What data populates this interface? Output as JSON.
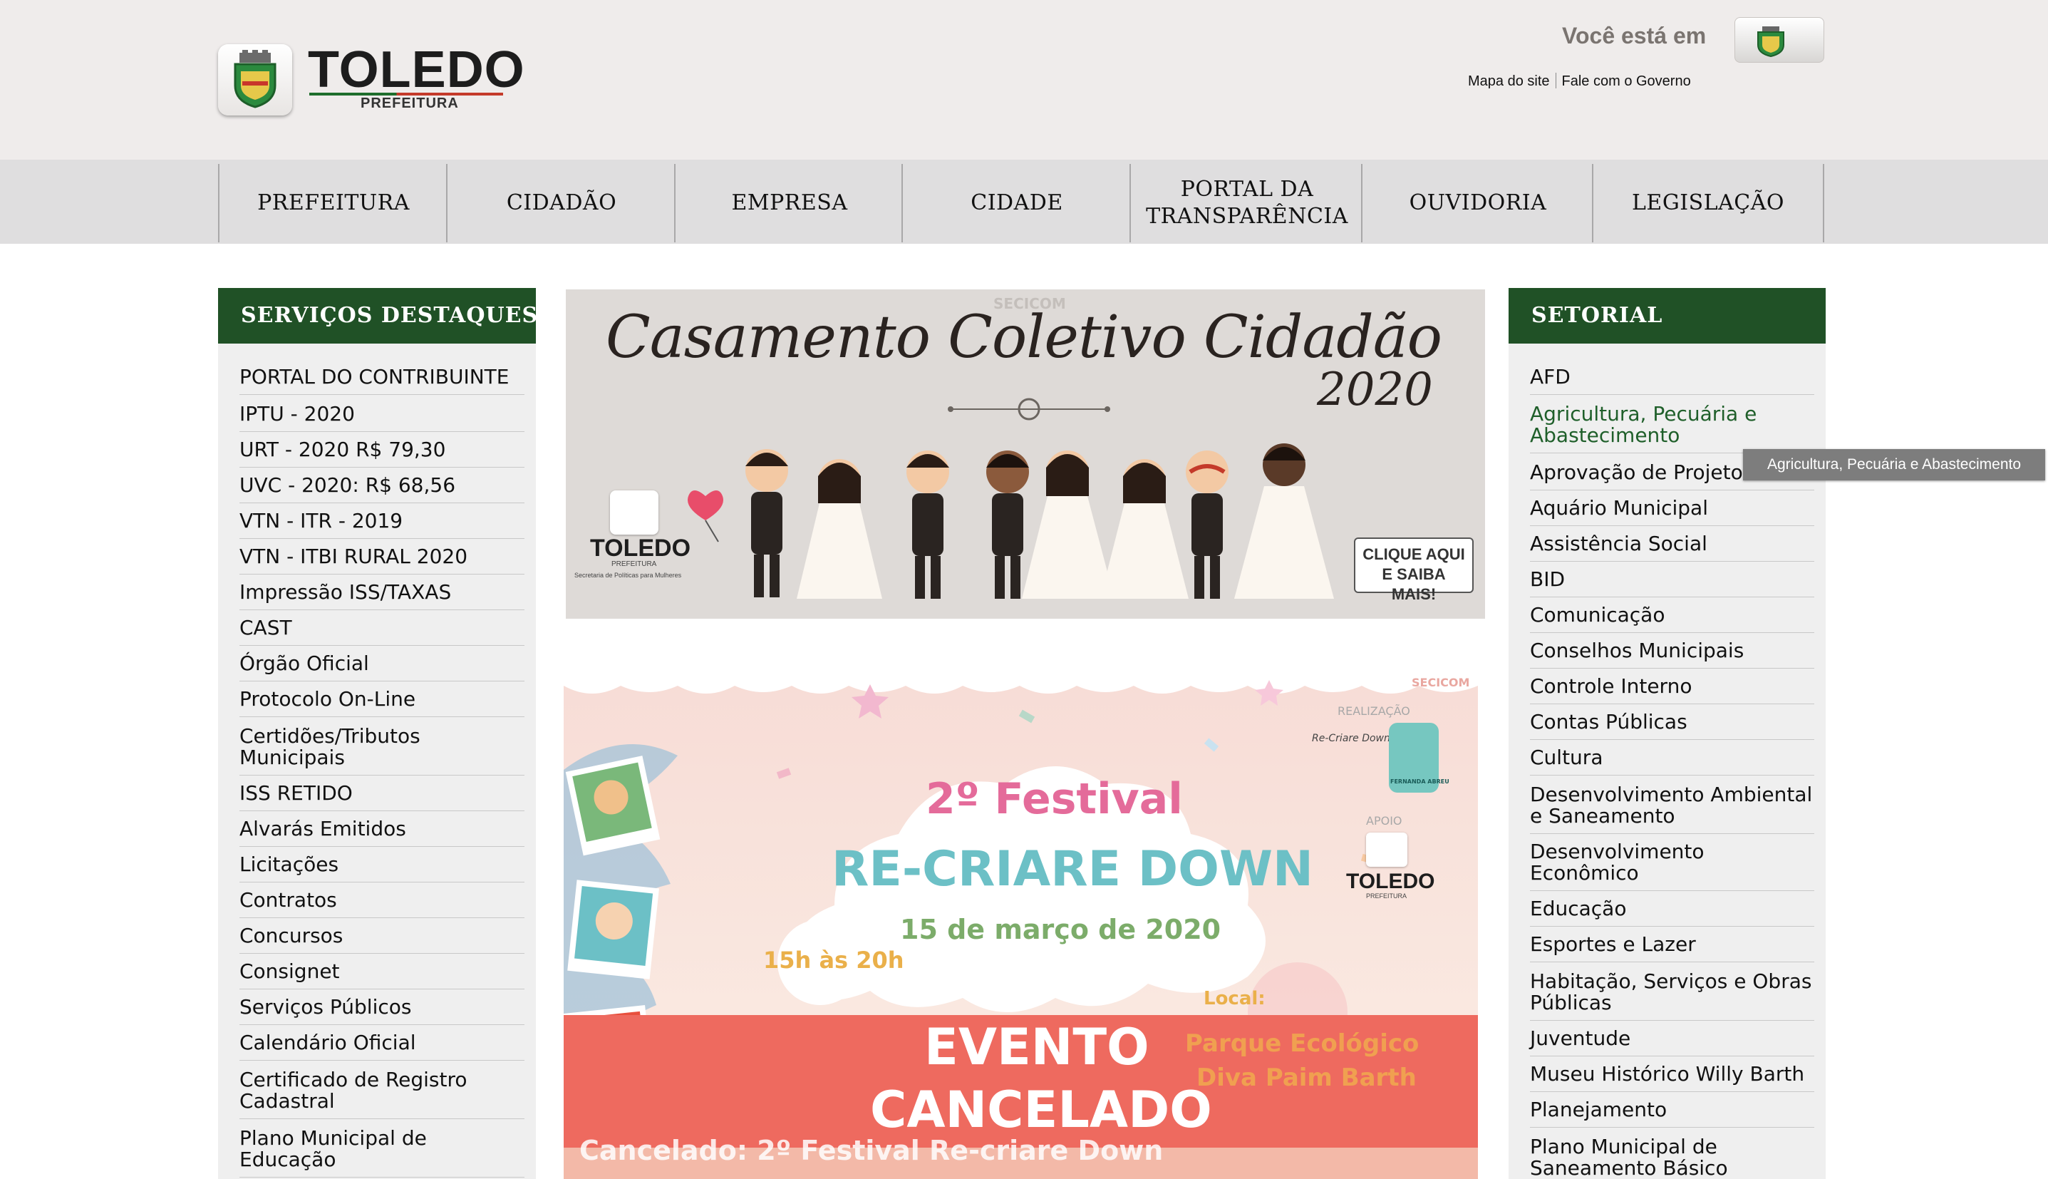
{
  "header": {
    "logo_title": "TOLEDO",
    "logo_subtitle": "PREFEITURA",
    "location_label": "Você está em",
    "location_icon": "city-crest-icon",
    "links": [
      "Mapa do site",
      "Fale com o Governo"
    ]
  },
  "nav": {
    "items": [
      "PREFEITURA",
      "CIDADÃO",
      "EMPRESA",
      "CIDADE",
      "PORTAL DA TRANSPARÊNCIA",
      "OUVIDORIA",
      "LEGISLAÇÃO"
    ]
  },
  "left_panel": {
    "title": "SERVIÇOS DESTAQUES",
    "items": [
      "PORTAL DO CONTRIBUINTE",
      "IPTU - 2020",
      "URT - 2020 R$ 79,30",
      "UVC - 2020: R$ 68,56",
      "VTN - ITR - 2019",
      "VTN - ITBI RURAL 2020",
      "Impressão ISS/TAXAS",
      "CAST",
      "Órgão Oficial",
      "Protocolo On-Line",
      "Certidões/Tributos Municipais",
      "ISS RETIDO",
      "Alvarás Emitidos",
      "Licitações",
      "Contratos",
      "Concursos",
      "Consignet",
      "Serviços Públicos",
      "Calendário Oficial",
      "Certificado de Registro Cadastral",
      "Plano Municipal de Educação"
    ]
  },
  "right_panel": {
    "title": "SETORIAL",
    "items": [
      "AFD",
      "Agricultura, Pecuária e Abastecimento",
      "Aprovação de Projetos",
      "Aquário Municipal",
      "Assistência Social",
      "BID",
      "Comunicação",
      "Conselhos Municipais",
      "Controle Interno",
      "Contas Públicas",
      "Cultura",
      "Desenvolvimento Ambiental e Saneamento",
      "Desenvolvimento Econômico",
      "Educação",
      "Esportes e Lazer",
      "Habitação, Serviços e Obras Públicas",
      "Juventude",
      "Museu Histórico Willy Barth",
      "Planejamento",
      "Plano Municipal de Saneamento Básico"
    ],
    "tooltip": "Agricultura, Pecuária e Abastecimento"
  },
  "banner1": {
    "watermark": "SECICOM",
    "title": "Casamento Coletivo Cidadão",
    "year": "2020",
    "logo_title": "TOLEDO",
    "logo_subtitle": "PREFEITURA",
    "logo_caption": "Secretaria de Políticas para Mulheres",
    "cta": "CLIQUE AQUI E SAIBA MAIS!"
  },
  "banner2": {
    "watermark": "SECICOM",
    "realization_label": "REALIZAÇÃO",
    "support_label": "APOIO",
    "logo_title": "TOLEDO",
    "logo_subtitle": "PREFEITURA",
    "partner_logo": "Re-Criare Down",
    "partner_logo2": "FERNANDA ABREU",
    "title_line1": "2º Festival",
    "title_line2": "RE-CRIARE DOWN",
    "date": "15 de março de 2020",
    "time": "15h às 20h",
    "location_label": "Local:",
    "location_line1": "Parque Ecológico",
    "location_line2": "Diva Paim Barth",
    "status_line1": "EVENTO",
    "status_line2": "CANCELADO",
    "caption": "Cancelado: 2º Festival Re-criare Down"
  },
  "colors": {
    "header_bg": "#efeceb",
    "nav_bg": "#dfdedf",
    "panel_head": "#205126",
    "panel_bg": "#efefef",
    "active_link": "#1f5f2a",
    "cancel_band": "#ee6a5f"
  }
}
